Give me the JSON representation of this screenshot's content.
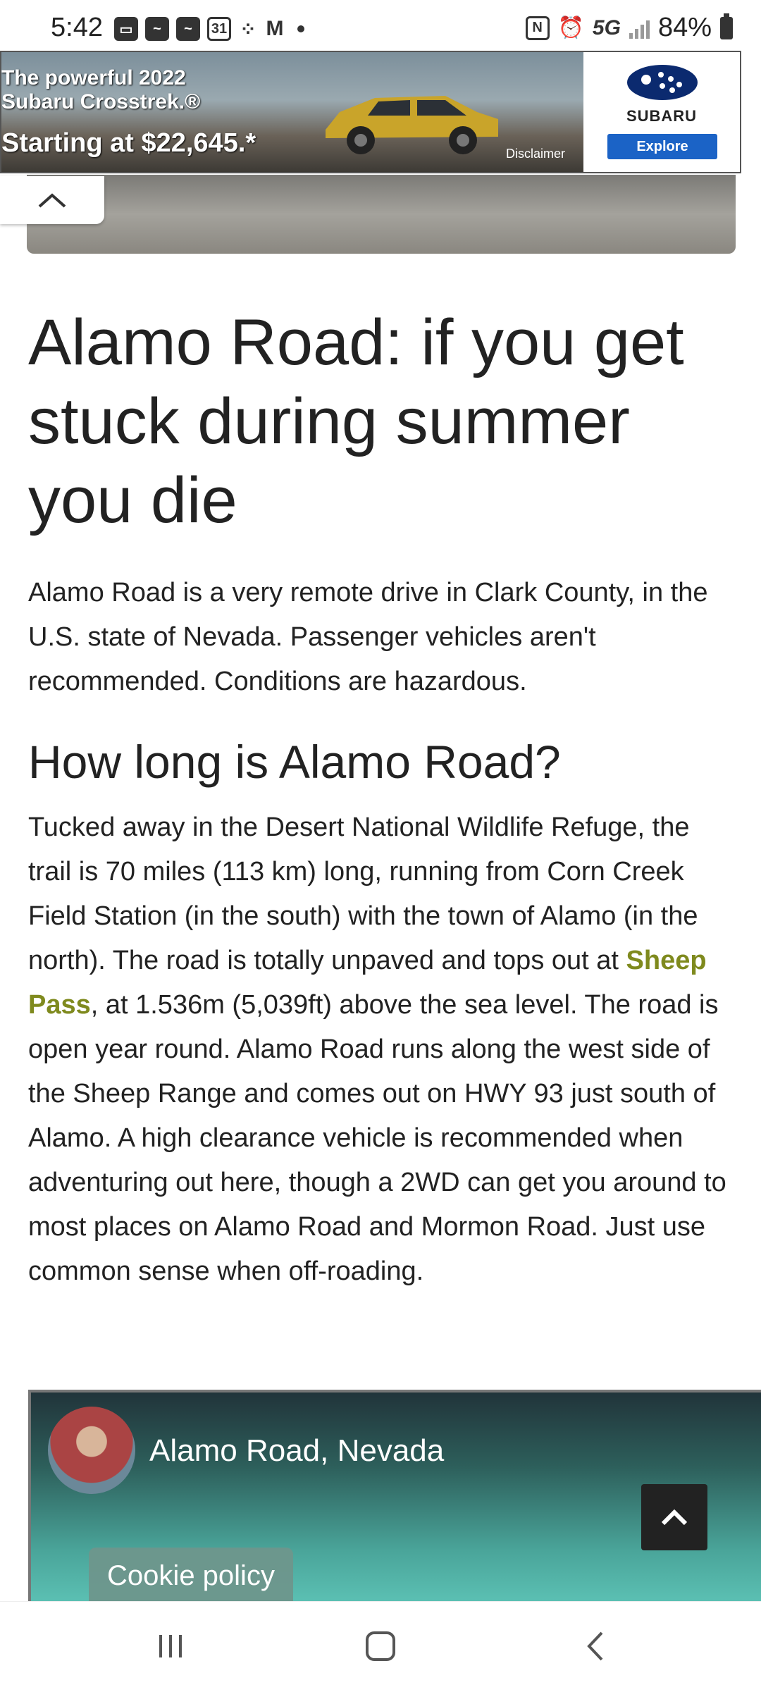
{
  "status_bar": {
    "time": "5:42",
    "network": "5G",
    "battery": "84%",
    "icons": [
      "message-icon",
      "app-icon",
      "app-icon",
      "calendar-icon",
      "dots-icon",
      "gmail-icon",
      "nfc-icon",
      "alarm-icon",
      "signal-icon",
      "battery-icon"
    ]
  },
  "ad": {
    "headline_line1": "The powerful 2022",
    "headline_line2": "Subaru Crosstrek.®",
    "price": "Starting at $22,645.*",
    "disclaimer": "Disclaimer",
    "brand": "SUBARU",
    "cta": "Explore"
  },
  "article": {
    "title": "Alamo Road: if you get stuck during summer you die",
    "intro": "Alamo Road is a very remote drive in Clark County, in the U.S. state of Nevada. Passenger vehicles aren't recommended. Conditions are hazardous.",
    "section_heading": "How long is Alamo Road?",
    "body_before_link": "Tucked away in the Desert National Wildlife Refuge, the trail is 70 miles (113 km) long, running from Corn Creek Field Station (in the south) with the town of Alamo (in the north). The road is totally unpaved and tops out at ",
    "link_text": "Sheep Pass",
    "body_after_link": ", at 1.536m (5,039ft) above the sea level. The road is open year round. Alamo Road runs along the west side of the Sheep Range and comes out on HWY 93 just south of Alamo. A high clearance vehicle is recommended when adventuring out here, though a 2WD can get you around to most places on Alamo Road and Mormon Road. Just use common sense when off-roading."
  },
  "video": {
    "title": "Alamo Road, Nevada"
  },
  "cookie": {
    "label": "Cookie policy"
  },
  "colors": {
    "link": "#7f8a1e",
    "explore_button": "#1b63c6"
  }
}
